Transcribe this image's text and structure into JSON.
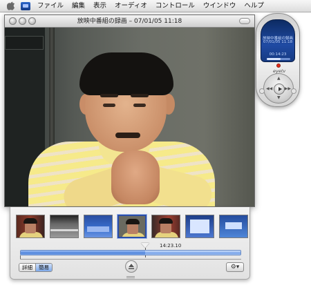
{
  "menubar": {
    "items": [
      "ファイル",
      "編集",
      "表示",
      "オーディオ",
      "コントロール",
      "ウインドウ",
      "ヘルプ"
    ]
  },
  "window": {
    "title": "放映中番組の録画 – 07/01/05 11:18"
  },
  "drawer": {
    "timecode": "14:23.10",
    "playhead_fraction": 0.565,
    "segmented": [
      "詳細",
      "簡易"
    ],
    "active_segment": "簡易",
    "thumbnails": [
      {
        "name": "thumb-speaker-red",
        "selected": false
      },
      {
        "name": "thumb-dark-room",
        "selected": false
      },
      {
        "name": "thumb-blue-screen",
        "selected": false
      },
      {
        "name": "thumb-interview",
        "selected": true
      },
      {
        "name": "thumb-speaker-red-2",
        "selected": false
      },
      {
        "name": "thumb-screen-text",
        "selected": false
      },
      {
        "name": "thumb-blue-slide",
        "selected": false
      }
    ],
    "eject_icon": "eject-icon",
    "gear_icon": "gear-icon",
    "gear_label": "⚙▾"
  },
  "remote": {
    "line1": "放映中番組の録画",
    "line2": "07/01/05 11:18",
    "time": "00:14:23",
    "progress_fraction": 0.6,
    "brand": "eyetv"
  },
  "colors": {
    "accent": "#5d8ee0",
    "record": "#e52a1a",
    "remote_screen": "#1f4aa3"
  }
}
